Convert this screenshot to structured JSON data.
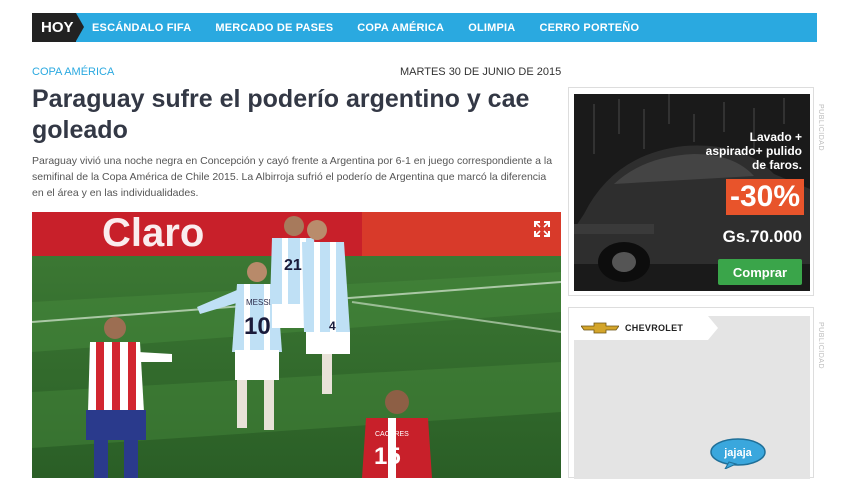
{
  "nav": {
    "hoy": "HOY",
    "items": [
      "ESCÁNDALO FIFA",
      "MERCADO DE PASES",
      "COPA AMÉRICA",
      "OLIMPIA",
      "CERRO PORTEÑO"
    ]
  },
  "article": {
    "category": "COPA AMÉRICA",
    "date": "MARTES 30 DE JUNIO DE 2015",
    "title": "Paraguay sufre el poderío argentino y cae goleado",
    "lead": "Paraguay vivió una noche negra en Concepción y cayó frente a Argentina por 6-1 en juego correspondiente a la semifinal de la Copa América de Chile 2015. La Albirroja sufrió el poderío de Argentina que marcó la diferencia en el área y en las individualidades.",
    "photo": {
      "sponsor_text": "Claro",
      "jersey_number_a": "10",
      "jersey_name_a": "MESSI",
      "jersey_number_b": "21",
      "jersey_number_c": "4",
      "jersey_number_d": "15",
      "jersey_name_d": "CACERES"
    }
  },
  "ads": {
    "label": "PUBLICIDAD",
    "ad1": {
      "copy_line1": "Lavado +",
      "copy_line2": "aspirado+ pulido",
      "copy_line3": "de faros.",
      "discount": "-30%",
      "price": "Gs.70.000",
      "button": "Comprar"
    },
    "ad2": {
      "brand": "CHEVROLET",
      "bubble": "jajaja"
    }
  },
  "colors": {
    "nav_bg": "#2aa9e0",
    "hoy_bg": "#222222",
    "accent": "#2aa9e0",
    "discount_bg": "#e8542b",
    "button_bg": "#3aa54a"
  }
}
